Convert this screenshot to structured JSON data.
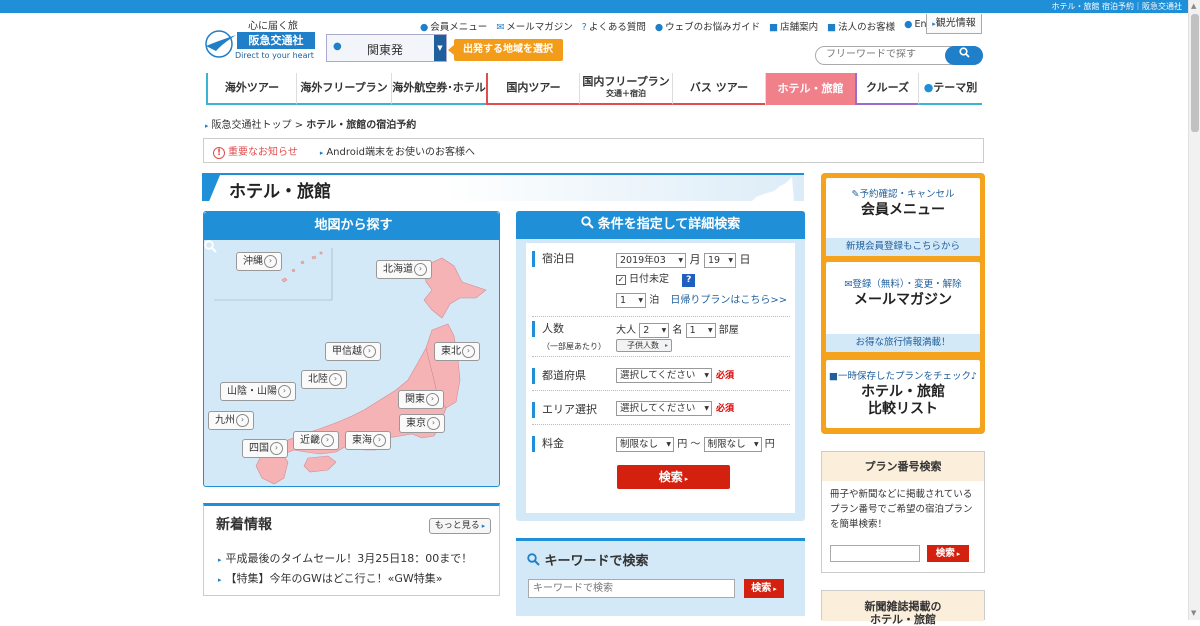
{
  "topbar": {
    "text": "ホテル・旅館 宿泊予約｜阪急交通社"
  },
  "logo": {
    "tagline": "心に届く旅",
    "name": "阪急交通社",
    "sub": "Direct to your heart"
  },
  "departure": {
    "value": "関東発",
    "hint": "出発する地域を選択"
  },
  "utility": [
    "会員メニュー",
    "メールマガジン",
    "よくある質問",
    "ウェブのお悩みガイド",
    "店舗案内",
    "法人のお客様",
    "English"
  ],
  "kanko": "観光情報",
  "search": {
    "placeholder": "フリーワードで探す"
  },
  "gnav": [
    {
      "label": "海外ツアー",
      "sub": ""
    },
    {
      "label": "海外フリープラン",
      "sub": ""
    },
    {
      "label": "海外航空券･ホテル",
      "sub": ""
    },
    {
      "label": "国内ツアー",
      "sub": ""
    },
    {
      "label": "国内フリープラン",
      "sub": "交通＋宿泊"
    },
    {
      "label": "バス ツアー",
      "sub": ""
    },
    {
      "label": "ホテル・旅館",
      "sub": ""
    },
    {
      "label": "クルーズ",
      "sub": ""
    },
    {
      "label": "テーマ別",
      "sub": ""
    }
  ],
  "breadcrumb": {
    "home": "阪急交通社トップ",
    "sep": ">",
    "current": "ホテル・旅館の宿泊予約"
  },
  "notice": {
    "important": "重要なお知らせ",
    "android": "Android端末をお使いのお客様へ"
  },
  "page_title": "ホテル・旅館",
  "map": {
    "heading": "地図から探す",
    "regions": [
      "沖縄",
      "北海道",
      "甲信越",
      "東北",
      "北陸",
      "山陰・山陽",
      "関東",
      "九州",
      "東京",
      "四国",
      "近畿",
      "東海"
    ]
  },
  "detail": {
    "heading": "条件を指定して詳細検索",
    "stay_label": "宿泊日",
    "date_ym": "2019年03",
    "month_unit": "月",
    "date_d": "19",
    "day_unit": "日",
    "undecided": "日付未定",
    "help": "?",
    "nights": "1",
    "nights_unit": "泊",
    "daytrip_link": "日帰りプランはこちら>>",
    "people_label": "人数",
    "people_note": "（一部屋あたり）",
    "adult_label": "大人",
    "adults": "2",
    "person_unit": "名",
    "rooms": "1",
    "room_unit": "部屋",
    "child_btn": "子供人数",
    "pref_label": "都道府県",
    "pref_value": "選択してください",
    "required": "必須",
    "area_label": "エリア選択",
    "area_value": "選択してください",
    "price_label": "料金",
    "price_min": "制限なし",
    "yen": "円",
    "tilde": "～",
    "price_max": "制限なし",
    "search_btn": "検索"
  },
  "news": {
    "heading": "新着情報",
    "more": "もっと見る",
    "items": [
      "平成最後のタイムセール！3月25日18：00まで！",
      "【特集】今年のGWはどこ行こ！«GW特集»"
    ]
  },
  "keyword": {
    "heading": "キーワードで検索",
    "placeholder": "キーワードで検索",
    "btn": "検索"
  },
  "side": {
    "member": {
      "small": "予約確認・キャンセル",
      "big": "会員メニュー",
      "foot": "新規会員登録もこちらから"
    },
    "mail": {
      "small": "登録（無料）・変更・解除",
      "big": "メールマガジン",
      "foot": "お得な旅行情報満載！"
    },
    "compare": {
      "small": "一時保存したプランをチェック♪",
      "big1": "ホテル・旅館",
      "big2": "比較リスト"
    }
  },
  "plan": {
    "heading": "プラン番号検索",
    "desc": "冊子や新聞などに掲載されているプラン番号でご希望の宿泊プランを簡単検索！",
    "btn": "検索"
  },
  "magazine": {
    "heading1": "新聞雑誌掲載の",
    "heading2": "ホテル・旅館"
  }
}
